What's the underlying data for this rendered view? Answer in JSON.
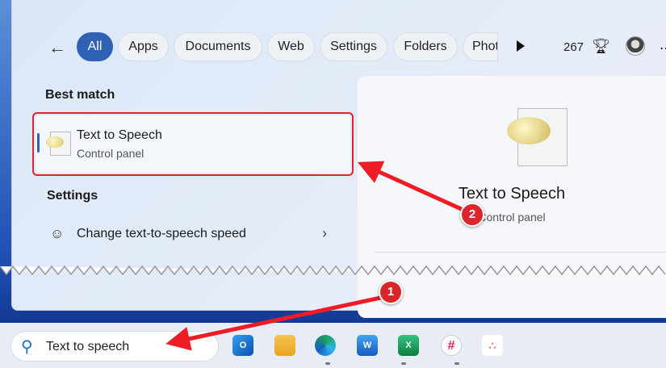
{
  "filters": {
    "all": "All",
    "apps": "Apps",
    "documents": "Documents",
    "web": "Web",
    "settings": "Settings",
    "folders": "Folders",
    "photos": "Phot"
  },
  "points": "267",
  "best_match": {
    "heading": "Best match",
    "title": "Text to Speech",
    "subtitle": "Control panel"
  },
  "settings": {
    "heading": "Settings",
    "items": [
      {
        "label": "Change text-to-speech speed"
      }
    ]
  },
  "preview": {
    "title": "Text to Speech",
    "subtitle": "Control panel"
  },
  "search": {
    "value": "Text to speech"
  },
  "taskbar": {
    "apps": [
      "Outlook",
      "File Explorer",
      "Edge",
      "Word",
      "Excel",
      "Slack",
      "Asana"
    ],
    "labels": {
      "outlook": "O",
      "word": "W",
      "excel": "X"
    }
  },
  "annotations": {
    "step1": "1",
    "step2": "2"
  },
  "colors": {
    "accent": "#2f62b5",
    "annotation": "#e0242b"
  }
}
